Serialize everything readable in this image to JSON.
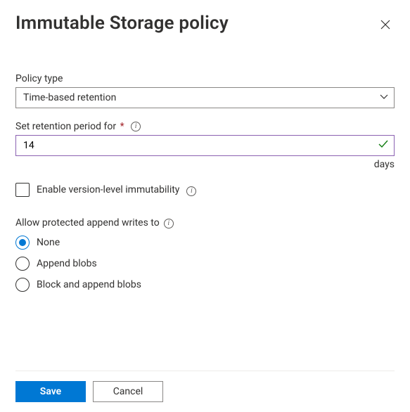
{
  "header": {
    "title": "Immutable Storage policy"
  },
  "fields": {
    "policyType": {
      "label": "Policy type",
      "selected": "Time-based retention"
    },
    "retentionPeriod": {
      "label": "Set retention period for",
      "value": "14",
      "unit": "days"
    },
    "versionLevel": {
      "label": "Enable version-level immutability",
      "checked": false
    },
    "appendWrites": {
      "label": "Allow protected append writes to",
      "options": [
        {
          "label": "None",
          "checked": true
        },
        {
          "label": "Append blobs",
          "checked": false
        },
        {
          "label": "Block and append blobs",
          "checked": false
        }
      ]
    }
  },
  "footer": {
    "save": "Save",
    "cancel": "Cancel"
  }
}
